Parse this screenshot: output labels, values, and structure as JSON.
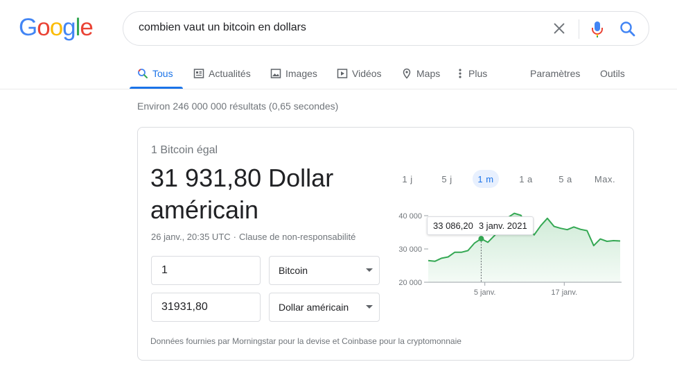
{
  "logo": {
    "letters": [
      "G",
      "o",
      "o",
      "g",
      "l",
      "e"
    ],
    "colors": [
      "#4285f4",
      "#ea4335",
      "#fbbc05",
      "#4285f4",
      "#34a853",
      "#ea4335"
    ]
  },
  "search": {
    "query": "combien vaut un bitcoin en dollars"
  },
  "tabs": [
    {
      "label": "Tous",
      "icon": "search-icon",
      "active": true
    },
    {
      "label": "Actualités",
      "icon": "news-icon"
    },
    {
      "label": "Images",
      "icon": "image-icon"
    },
    {
      "label": "Vidéos",
      "icon": "video-icon"
    },
    {
      "label": "Maps",
      "icon": "map-pin-icon"
    },
    {
      "label": "Plus",
      "icon": "more-vert-icon"
    }
  ],
  "tools": {
    "settings": "Paramètres",
    "tools": "Outils"
  },
  "result_stats": "Environ 246 000 000 résultats (0,65 secondes)",
  "converter": {
    "equals_label": "1 Bitcoin égal",
    "result_value": "31 931,80 Dollar américain",
    "timestamp": "26 janv., 20:35 UTC",
    "separator": "·",
    "disclaimer": "Clause de non-responsabilité",
    "from_amount": "1",
    "from_currency": "Bitcoin",
    "to_amount": "31931,80",
    "to_currency": "Dollar américain",
    "source": "Données fournies par Morningstar pour la devise et Coinbase pour la cryptomonnaie",
    "ranges": [
      "1 j",
      "5 j",
      "1 m",
      "1 a",
      "5 a",
      "Max."
    ],
    "active_range": "1 m",
    "tooltip": {
      "value": "33 086,20",
      "date": "3 janv. 2021"
    }
  },
  "colors": {
    "accent": "#1a73e8",
    "chart_line": "#34a853",
    "chart_fill": "#e6f4ea"
  },
  "chart_data": {
    "type": "area",
    "title": "",
    "xlabel": "",
    "ylabel": "",
    "ylim": [
      20000,
      40000
    ],
    "yticks": [
      20000,
      30000,
      40000
    ],
    "ytick_labels": [
      "20 000",
      "30 000",
      "40 000"
    ],
    "xtick_labels": [
      "5 janv.",
      "17 janv."
    ],
    "xticks_index": [
      8,
      20
    ],
    "series": [
      {
        "values": [
          26500,
          26300,
          27200,
          27600,
          29000,
          29000,
          29500,
          31800,
          33086,
          32000,
          34000,
          36200,
          39400,
          40700,
          40100,
          36700,
          34200,
          37000,
          39200,
          36800,
          36200,
          35800,
          36600,
          35900,
          35500,
          31000,
          33000,
          32300,
          32500,
          32400
        ]
      }
    ],
    "highlight_index": 8,
    "grid": false,
    "legend": "none"
  }
}
